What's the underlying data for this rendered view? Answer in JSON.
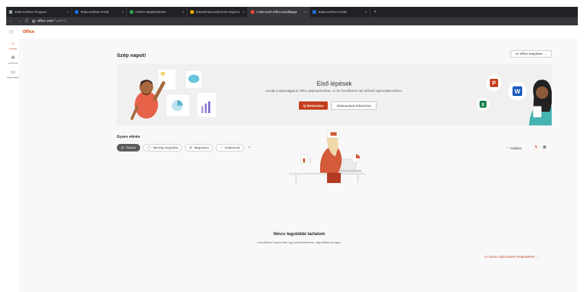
{
  "browser": {
    "tabs": [
      {
        "label": "Tesla-szolfver Program",
        "color": "#9aa0a6",
        "active": false
      },
      {
        "label": "Tesla-szolfver Portál",
        "color": "#1a73e8",
        "active": false
      },
      {
        "label": "KRÉTA Bejelentkezés",
        "color": "#34a853",
        "active": false
      },
      {
        "label": "Üdvözli Microsoft (ezen lépés le",
        "color": "#f9ab00",
        "active": false
      },
      {
        "label": "A Microsoft Office kezdőlapja",
        "color": "#e8453c",
        "active": true
      },
      {
        "label": "Tesla-szolfver Portál",
        "color": "#1a73e8",
        "active": false
      }
    ],
    "close_symbol": "×",
    "new_tab_symbol": "+",
    "back_symbol": "←",
    "forward_symbol": "→",
    "reload_symbol": "C",
    "url_host": "office.com",
    "url_path": "/?auth=2"
  },
  "app": {
    "waffle_icon": "waffle-icon",
    "waffle_symbol": "⁝⁝⁝",
    "brand": "Office"
  },
  "rail": {
    "items": [
      {
        "icon": "home-icon",
        "symbol": "⌂",
        "label": "Kezdőlap"
      },
      {
        "icon": "create-icon",
        "symbol": "⊕",
        "label": "Létrehozás"
      },
      {
        "icon": "folder-icon",
        "symbol": "▭",
        "label": "Saját tartalom"
      }
    ]
  },
  "main": {
    "greeting": "Szép napot!",
    "install_button": "Az Office telepítése",
    "install_chevron": "⌄",
    "banner": {
      "title": "Első lépések",
      "text": "Kezdje el újdonsággal az Office alkalmazásokban. Az Ön hozzáférése már elérhető saját adatkezelőben.",
      "primary_button": "Új létrehozása",
      "secondary_button": "Alkalmazások felfedezése"
    },
    "quick_access": {
      "title": "Gyors elérés",
      "filters": [
        {
          "label": "Összes",
          "icon": "clock-icon",
          "symbol": "◷",
          "active": true
        },
        {
          "label": "Nemrég megnyitva",
          "icon": "recent-icon",
          "symbol": "◯",
          "active": false
        },
        {
          "label": "Megosztva",
          "icon": "shared-icon",
          "symbol": "⊞",
          "active": false
        },
        {
          "label": "Kedvencek",
          "icon": "star-icon",
          "symbol": "☆",
          "active": false
        }
      ],
      "add_filter_symbol": "+",
      "upload_label": "Feltöltés",
      "upload_symbol": "↑",
      "sort_symbol": "⇅",
      "view_symbol": "▦"
    },
    "empty_state": {
      "title": "Nincs legutóbbi tartalom",
      "text": "A kezdéshez hozzon létre egy új dokumentumot, vagy töltsön fel egyet.",
      "link": "Az összes saját tartalom megtekintése →"
    }
  },
  "colors": {
    "brand_orange": "#d83b01",
    "button_red": "#c43e1c",
    "banner_bg": "#f0f0f0",
    "page_bg": "#f8f8f8"
  },
  "illustration_icons": [
    {
      "icon": "powerpoint-icon",
      "letter": "P",
      "color": "#c43e1c"
    },
    {
      "icon": "word-icon",
      "letter": "W",
      "color": "#185abd"
    },
    {
      "icon": "excel-icon",
      "letter": "X",
      "color": "#107c41"
    }
  ]
}
